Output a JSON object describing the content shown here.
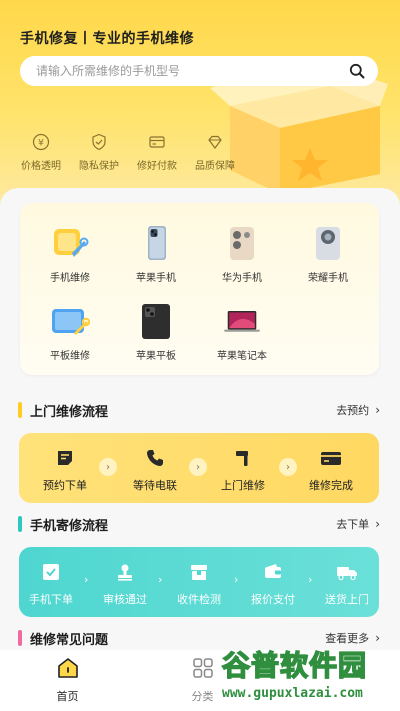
{
  "header": {
    "title": "手机修复丨专业的手机维修",
    "search_placeholder": "请输入所需维修的手机型号"
  },
  "features": [
    {
      "label": "价格透明",
      "icon": "yen-coin-icon"
    },
    {
      "label": "隐私保护",
      "icon": "shield-check-icon"
    },
    {
      "label": "修好付款",
      "icon": "card-icon"
    },
    {
      "label": "品质保障",
      "icon": "diamond-icon"
    }
  ],
  "categories": [
    {
      "label": "手机维修",
      "icon": "phone-repair-icon"
    },
    {
      "label": "苹果手机",
      "icon": "iphone-icon"
    },
    {
      "label": "华为手机",
      "icon": "huawei-phone-icon"
    },
    {
      "label": "荣耀手机",
      "icon": "honor-phone-icon"
    },
    {
      "label": "平板维修",
      "icon": "tablet-repair-icon"
    },
    {
      "label": "苹果平板",
      "icon": "ipad-icon"
    },
    {
      "label": "苹果笔记本",
      "icon": "macbook-icon"
    }
  ],
  "onsite": {
    "title": "上门维修流程",
    "link": "去预约",
    "steps": [
      "预约下单",
      "等待电联",
      "上门维修",
      "维修完成"
    ]
  },
  "mailin": {
    "title": "手机寄修流程",
    "link": "去下单",
    "steps": [
      "手机下单",
      "审核通过",
      "收件检测",
      "报价支付",
      "送货上门"
    ]
  },
  "faq": {
    "title": "维修常见问题",
    "link": "查看更多"
  },
  "tabs": [
    {
      "label": "首页",
      "icon": "home-icon"
    },
    {
      "label": "分类",
      "icon": "grid-icon"
    }
  ],
  "watermark": {
    "name": "谷普软件园",
    "url": "www.gupuxlazai.com"
  },
  "colors": {
    "brand_yellow": "#ffd84a",
    "accent_cyan": "#4fd6d0",
    "faq_bar": "#f06aa0"
  }
}
